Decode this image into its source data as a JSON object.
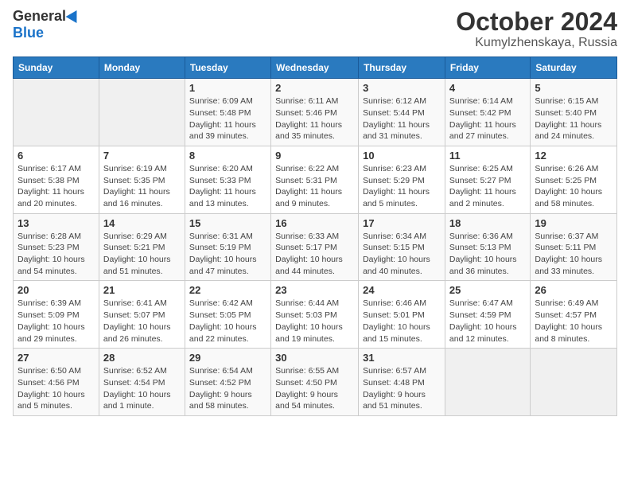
{
  "logo": {
    "general": "General",
    "blue": "Blue"
  },
  "title": {
    "month": "October 2024",
    "location": "Kumylzhenskaya, Russia"
  },
  "headers": [
    "Sunday",
    "Monday",
    "Tuesday",
    "Wednesday",
    "Thursday",
    "Friday",
    "Saturday"
  ],
  "weeks": [
    [
      {
        "day": "",
        "sunrise": "",
        "sunset": "",
        "daylight": ""
      },
      {
        "day": "",
        "sunrise": "",
        "sunset": "",
        "daylight": ""
      },
      {
        "day": "1",
        "sunrise": "Sunrise: 6:09 AM",
        "sunset": "Sunset: 5:48 PM",
        "daylight": "Daylight: 11 hours and 39 minutes."
      },
      {
        "day": "2",
        "sunrise": "Sunrise: 6:11 AM",
        "sunset": "Sunset: 5:46 PM",
        "daylight": "Daylight: 11 hours and 35 minutes."
      },
      {
        "day": "3",
        "sunrise": "Sunrise: 6:12 AM",
        "sunset": "Sunset: 5:44 PM",
        "daylight": "Daylight: 11 hours and 31 minutes."
      },
      {
        "day": "4",
        "sunrise": "Sunrise: 6:14 AM",
        "sunset": "Sunset: 5:42 PM",
        "daylight": "Daylight: 11 hours and 27 minutes."
      },
      {
        "day": "5",
        "sunrise": "Sunrise: 6:15 AM",
        "sunset": "Sunset: 5:40 PM",
        "daylight": "Daylight: 11 hours and 24 minutes."
      }
    ],
    [
      {
        "day": "6",
        "sunrise": "Sunrise: 6:17 AM",
        "sunset": "Sunset: 5:38 PM",
        "daylight": "Daylight: 11 hours and 20 minutes."
      },
      {
        "day": "7",
        "sunrise": "Sunrise: 6:19 AM",
        "sunset": "Sunset: 5:35 PM",
        "daylight": "Daylight: 11 hours and 16 minutes."
      },
      {
        "day": "8",
        "sunrise": "Sunrise: 6:20 AM",
        "sunset": "Sunset: 5:33 PM",
        "daylight": "Daylight: 11 hours and 13 minutes."
      },
      {
        "day": "9",
        "sunrise": "Sunrise: 6:22 AM",
        "sunset": "Sunset: 5:31 PM",
        "daylight": "Daylight: 11 hours and 9 minutes."
      },
      {
        "day": "10",
        "sunrise": "Sunrise: 6:23 AM",
        "sunset": "Sunset: 5:29 PM",
        "daylight": "Daylight: 11 hours and 5 minutes."
      },
      {
        "day": "11",
        "sunrise": "Sunrise: 6:25 AM",
        "sunset": "Sunset: 5:27 PM",
        "daylight": "Daylight: 11 hours and 2 minutes."
      },
      {
        "day": "12",
        "sunrise": "Sunrise: 6:26 AM",
        "sunset": "Sunset: 5:25 PM",
        "daylight": "Daylight: 10 hours and 58 minutes."
      }
    ],
    [
      {
        "day": "13",
        "sunrise": "Sunrise: 6:28 AM",
        "sunset": "Sunset: 5:23 PM",
        "daylight": "Daylight: 10 hours and 54 minutes."
      },
      {
        "day": "14",
        "sunrise": "Sunrise: 6:29 AM",
        "sunset": "Sunset: 5:21 PM",
        "daylight": "Daylight: 10 hours and 51 minutes."
      },
      {
        "day": "15",
        "sunrise": "Sunrise: 6:31 AM",
        "sunset": "Sunset: 5:19 PM",
        "daylight": "Daylight: 10 hours and 47 minutes."
      },
      {
        "day": "16",
        "sunrise": "Sunrise: 6:33 AM",
        "sunset": "Sunset: 5:17 PM",
        "daylight": "Daylight: 10 hours and 44 minutes."
      },
      {
        "day": "17",
        "sunrise": "Sunrise: 6:34 AM",
        "sunset": "Sunset: 5:15 PM",
        "daylight": "Daylight: 10 hours and 40 minutes."
      },
      {
        "day": "18",
        "sunrise": "Sunrise: 6:36 AM",
        "sunset": "Sunset: 5:13 PM",
        "daylight": "Daylight: 10 hours and 36 minutes."
      },
      {
        "day": "19",
        "sunrise": "Sunrise: 6:37 AM",
        "sunset": "Sunset: 5:11 PM",
        "daylight": "Daylight: 10 hours and 33 minutes."
      }
    ],
    [
      {
        "day": "20",
        "sunrise": "Sunrise: 6:39 AM",
        "sunset": "Sunset: 5:09 PM",
        "daylight": "Daylight: 10 hours and 29 minutes."
      },
      {
        "day": "21",
        "sunrise": "Sunrise: 6:41 AM",
        "sunset": "Sunset: 5:07 PM",
        "daylight": "Daylight: 10 hours and 26 minutes."
      },
      {
        "day": "22",
        "sunrise": "Sunrise: 6:42 AM",
        "sunset": "Sunset: 5:05 PM",
        "daylight": "Daylight: 10 hours and 22 minutes."
      },
      {
        "day": "23",
        "sunrise": "Sunrise: 6:44 AM",
        "sunset": "Sunset: 5:03 PM",
        "daylight": "Daylight: 10 hours and 19 minutes."
      },
      {
        "day": "24",
        "sunrise": "Sunrise: 6:46 AM",
        "sunset": "Sunset: 5:01 PM",
        "daylight": "Daylight: 10 hours and 15 minutes."
      },
      {
        "day": "25",
        "sunrise": "Sunrise: 6:47 AM",
        "sunset": "Sunset: 4:59 PM",
        "daylight": "Daylight: 10 hours and 12 minutes."
      },
      {
        "day": "26",
        "sunrise": "Sunrise: 6:49 AM",
        "sunset": "Sunset: 4:57 PM",
        "daylight": "Daylight: 10 hours and 8 minutes."
      }
    ],
    [
      {
        "day": "27",
        "sunrise": "Sunrise: 6:50 AM",
        "sunset": "Sunset: 4:56 PM",
        "daylight": "Daylight: 10 hours and 5 minutes."
      },
      {
        "day": "28",
        "sunrise": "Sunrise: 6:52 AM",
        "sunset": "Sunset: 4:54 PM",
        "daylight": "Daylight: 10 hours and 1 minute."
      },
      {
        "day": "29",
        "sunrise": "Sunrise: 6:54 AM",
        "sunset": "Sunset: 4:52 PM",
        "daylight": "Daylight: 9 hours and 58 minutes."
      },
      {
        "day": "30",
        "sunrise": "Sunrise: 6:55 AM",
        "sunset": "Sunset: 4:50 PM",
        "daylight": "Daylight: 9 hours and 54 minutes."
      },
      {
        "day": "31",
        "sunrise": "Sunrise: 6:57 AM",
        "sunset": "Sunset: 4:48 PM",
        "daylight": "Daylight: 9 hours and 51 minutes."
      },
      {
        "day": "",
        "sunrise": "",
        "sunset": "",
        "daylight": ""
      },
      {
        "day": "",
        "sunrise": "",
        "sunset": "",
        "daylight": ""
      }
    ]
  ]
}
